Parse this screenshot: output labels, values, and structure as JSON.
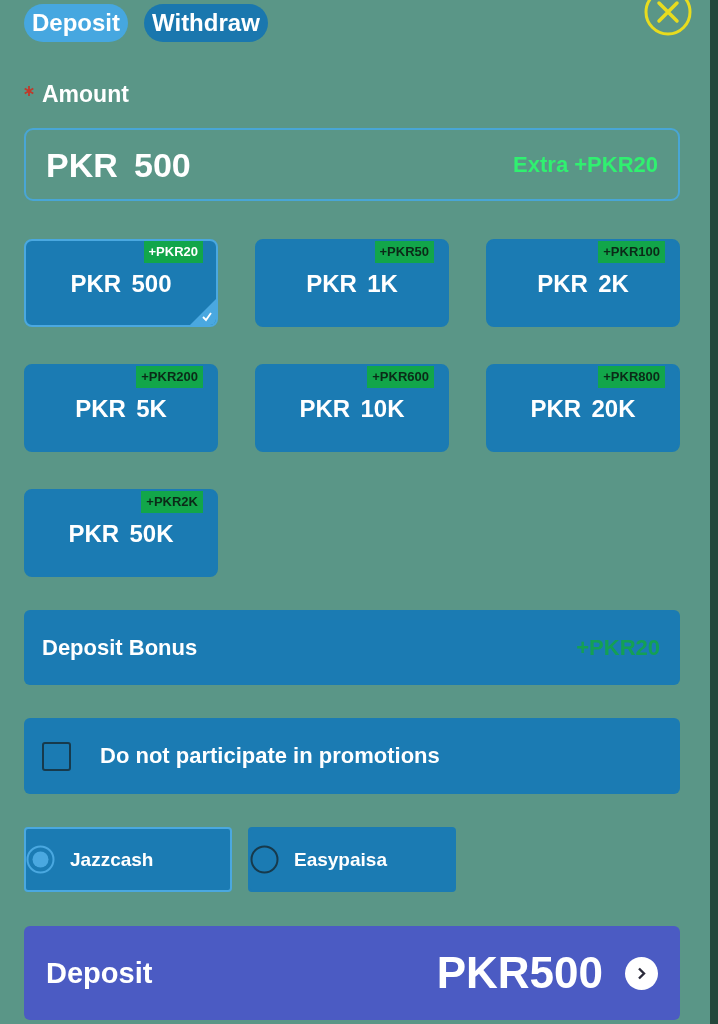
{
  "tabs": [
    {
      "label": "Deposit",
      "selected": true
    },
    {
      "label": "Withdraw",
      "selected": false
    }
  ],
  "amount_field": {
    "label": "Amount",
    "required": true,
    "value": "PKR 500",
    "extra": "Extra +PKR20"
  },
  "amount_options": [
    {
      "label": "PKR 500",
      "badge": "+PKR20",
      "selected": true
    },
    {
      "label": "PKR 1K",
      "badge": "+PKR50",
      "selected": false
    },
    {
      "label": "PKR 2K",
      "badge": "+PKR100",
      "selected": false
    },
    {
      "label": "PKR 5K",
      "badge": "+PKR200",
      "selected": false
    },
    {
      "label": "PKR 10K",
      "badge": "+PKR600",
      "selected": false
    },
    {
      "label": "PKR 20K",
      "badge": "+PKR800",
      "selected": false
    },
    {
      "label": "PKR 50K",
      "badge": "+PKR2K",
      "selected": false
    }
  ],
  "bonus": {
    "label": "Deposit Bonus",
    "value": "+PKR20"
  },
  "promotion_opt_out": {
    "label": "Do not participate in promotions",
    "checked": false
  },
  "payment_methods": [
    {
      "label": "Jazzcash",
      "selected": true
    },
    {
      "label": "Easypaisa",
      "selected": false
    }
  ],
  "submit": {
    "label": "Deposit",
    "amount": "PKR500"
  }
}
